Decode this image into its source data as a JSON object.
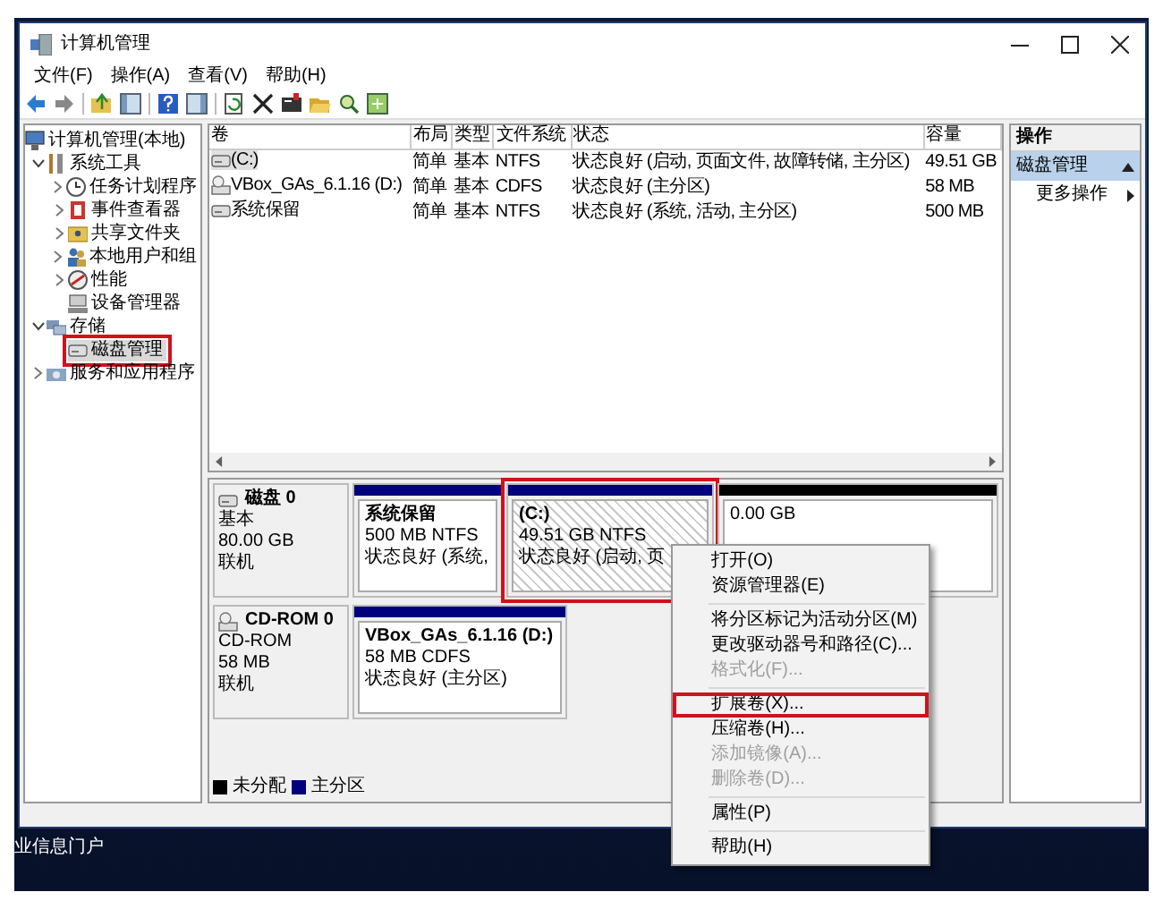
{
  "window": {
    "title": "计算机管理"
  },
  "menu_bar": [
    "文件(F)",
    "操作(A)",
    "查看(V)",
    "帮助(H)"
  ],
  "tree": [
    {
      "label": "计算机管理(本地)",
      "selected": false,
      "children": [
        {
          "label": "系统工具",
          "expanded": true,
          "selected": false,
          "children": [
            {
              "label": "任务计划程序",
              "expanded": false,
              "selected": false
            },
            {
              "label": "事件查看器",
              "expanded": false,
              "selected": false
            },
            {
              "label": "共享文件夹",
              "expanded": false,
              "selected": false
            },
            {
              "label": "本地用户和组",
              "expanded": false,
              "selected": false
            },
            {
              "label": "性能",
              "expanded": false,
              "selected": false
            },
            {
              "label": "设备管理器",
              "selected": false
            }
          ]
        },
        {
          "label": "存储",
          "expanded": true,
          "selected": false,
          "children": [
            {
              "label": "磁盘管理",
              "selected": true,
              "highlighted": true
            }
          ]
        },
        {
          "label": "服务和应用程序",
          "expanded": false,
          "selected": false
        }
      ]
    }
  ],
  "volume_table": {
    "columns": [
      "卷",
      "布局",
      "类型",
      "文件系统",
      "状态",
      "容量"
    ],
    "rows": [
      {
        "cells": [
          "(C:)",
          "简单",
          "基本",
          "NTFS",
          "状态良好 (启动, 页面文件, 故障转储, 主分区)",
          "49.51 GB"
        ],
        "selected": true
      },
      {
        "cells": [
          "VBox_GAs_6.1.16 (D:)",
          "简单",
          "基本",
          "CDFS",
          "状态良好 (主分区)",
          "58 MB"
        ],
        "selected": false
      },
      {
        "cells": [
          "系统保留",
          "简单",
          "基本",
          "NTFS",
          "状态良好 (系统, 活动, 主分区)",
          "500 MB"
        ],
        "selected": false
      }
    ]
  },
  "disks": [
    {
      "name": "磁盘 0",
      "lines": [
        "基本",
        "80.00 GB",
        "联机"
      ],
      "partitions": [
        {
          "lines": [
            "系统保留",
            "500 MB NTFS",
            "状态良好 (系统,"
          ],
          "color": "#00007f",
          "selected": false
        },
        {
          "lines": [
            "(C:)",
            "49.51 GB NTFS",
            "状态良好 (启动, 页"
          ],
          "color": "#00007f",
          "selected": true,
          "highlighted": true
        },
        {
          "lines": [
            "0.00 GB"
          ],
          "color": "#000000",
          "selected": false
        }
      ]
    },
    {
      "name": "CD-ROM 0",
      "lines": [
        "CD-ROM",
        "58 MB",
        "联机"
      ],
      "partitions": [
        {
          "lines": [
            "VBox_GAs_6.1.16 (D:)",
            "58 MB CDFS",
            "状态良好 (主分区)"
          ],
          "color": "#00007f",
          "selected": false
        }
      ]
    }
  ],
  "legend": [
    {
      "label": "未分配",
      "color": "#000000"
    },
    {
      "label": "主分区",
      "color": "#00007f"
    }
  ],
  "actions": {
    "header": "操作",
    "sections": [
      {
        "title": "磁盘管理",
        "expanded": true,
        "items": [
          "更多操作"
        ]
      }
    ]
  },
  "context_menu": {
    "groups": [
      [
        {
          "label": "打开(O)",
          "disabled": false
        },
        {
          "label": "资源管理器(E)",
          "disabled": false
        }
      ],
      [
        {
          "label": "将分区标记为活动分区(M)",
          "disabled": false
        },
        {
          "label": "更改驱动器号和路径(C)...",
          "disabled": false
        },
        {
          "label": "格式化(F)...",
          "disabled": true
        }
      ],
      [
        {
          "label": "扩展卷(X)...",
          "disabled": false,
          "highlighted": true
        },
        {
          "label": "压缩卷(H)...",
          "disabled": false
        },
        {
          "label": "添加镜像(A)...",
          "disabled": true
        },
        {
          "label": "删除卷(D)...",
          "disabled": true
        }
      ],
      [
        {
          "label": "属性(P)",
          "disabled": false
        }
      ],
      [
        {
          "label": "帮助(H)",
          "disabled": false
        }
      ]
    ]
  },
  "desktop": {
    "icon_label": "业信息门户"
  }
}
